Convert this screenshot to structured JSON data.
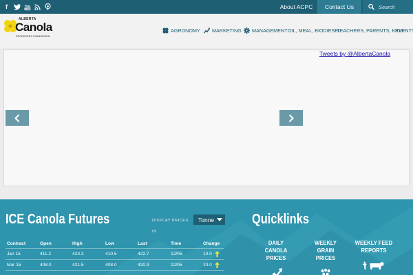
{
  "topbar": {
    "social": [
      {
        "name": "facebook-icon",
        "glyph": "f"
      },
      {
        "name": "twitter-icon",
        "glyph": "t"
      },
      {
        "name": "youtube-icon",
        "glyph": "▶"
      },
      {
        "name": "rss-icon",
        "glyph": "≈"
      },
      {
        "name": "podcast-icon",
        "glyph": "◉"
      }
    ],
    "about_label": "About ACPC",
    "contact_label": "Contact Us",
    "search_placeholder": "Search"
  },
  "logo": {
    "line1": "ALBERTA",
    "line2": "Canola",
    "line3": "PRODUCERS COMMISSION"
  },
  "nav": {
    "agronomy": "AGRONOMY",
    "marketing": "MARKETING",
    "management": "MANAGEMENT",
    "oil": "OIL, MEAL, BIODIESEL",
    "teachers": "TEACHERS, PARENTS, KIDS",
    "events": "EVENTS"
  },
  "content": {
    "tweets_link": "Tweets by @AlbertaCanola"
  },
  "futures": {
    "title": "ICE Canola Futures",
    "display_label": "DISPLAY PRICES IN",
    "unit": "Tonne",
    "columns": [
      "Contract",
      "Open",
      "High",
      "Low",
      "Last",
      "Time",
      "Change"
    ],
    "rows": [
      {
        "contract": "Jan 15",
        "open": "411.2",
        "high": "423.3",
        "low": "410.5",
        "last": "422.7",
        "time": "12/05",
        "change": "10.0"
      },
      {
        "contract": "Mar 15",
        "open": "408.0",
        "high": "421.5",
        "low": "408.0",
        "last": "420.9",
        "time": "12/05",
        "change": "10.0"
      }
    ]
  },
  "quicklinks": {
    "title": "Quicklinks",
    "items": [
      {
        "line1": "DAILY CANOLA",
        "line2": "PRICES",
        "icon": "price-chart-icon"
      },
      {
        "line1": "WEEKLY GRAIN",
        "line2": "PRICES",
        "icon": "grain-icon"
      },
      {
        "line1": "WEEKLY FEED",
        "line2": "REPORTS",
        "icon": "cow-icon"
      }
    ]
  },
  "colors": {
    "topbar": "#1e5f74",
    "footer": "#2f94ad",
    "nav_text": "#1f5e72",
    "logo_yellow": "#f2d40f"
  }
}
